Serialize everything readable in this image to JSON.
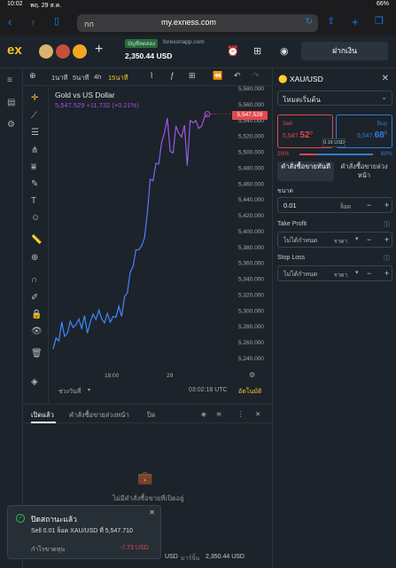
{
  "status_bar": {
    "time": "10:02",
    "date": "พฤ. 29 ส.ค.",
    "battery": "66%"
  },
  "browser": {
    "tab_label": "กก",
    "url": "my.exness.com"
  },
  "app": {
    "logo": "ex",
    "account_badge": "บัญชีทดลอง",
    "account_server": "forexonapp.com",
    "balance": "2,350.44 USD",
    "deposit_label": "ฝากเงิน"
  },
  "chart_toolbar": {
    "timeframes": [
      "1นาที",
      "5นาที",
      "4h",
      "15นาที"
    ],
    "active_timeframe": "15นาที"
  },
  "chart": {
    "title": "Gold vs US Dollar",
    "quote": "5,547.529 +11.732 (+0.21%)",
    "current_price": "5,547.529",
    "x_labels": [
      "18:00",
      "29"
    ],
    "range_label": "ช่วงวันที่",
    "clock": "03:02:18 UTC",
    "auto_label": "อัตโนมัติ"
  },
  "chart_data": {
    "type": "line",
    "title": "Gold vs US Dollar",
    "ylim": [
      5240,
      5580
    ],
    "yticks": [
      5580,
      5560,
      5540,
      5520,
      5500,
      5480,
      5460,
      5440,
      5420,
      5400,
      5380,
      5360,
      5340,
      5320,
      5300,
      5280,
      5260,
      5240
    ],
    "y_tick_labels": [
      "5,580.000",
      "5,560.000",
      "5,540.000",
      "5,520.000",
      "5,500.000",
      "5,480.000",
      "5,460.000",
      "5,440.000",
      "5,420.000",
      "5,400.000",
      "5,380.000",
      "5,360.000",
      "5,340.000",
      "5,320.000",
      "5,300.000",
      "5,280.000",
      "5,260.000",
      "5,240.000"
    ],
    "xlabel": "",
    "ylabel": "",
    "grid": false,
    "series": [
      {
        "values": [
          5252,
          5266,
          5262,
          5286,
          5268,
          5272,
          5287,
          5279,
          5283,
          5290,
          5278,
          5294,
          5272,
          5286,
          5296,
          5289,
          5301,
          5290,
          5285,
          5297,
          5286,
          5293,
          5292,
          5306,
          5293,
          5318,
          5323,
          5349,
          5356,
          5377,
          5377,
          5382,
          5392,
          5423,
          5466,
          5464,
          5486,
          5485,
          5512,
          5525,
          5543,
          5501,
          5499,
          5533,
          5524,
          5519,
          5534,
          5483,
          5540,
          5537,
          5540,
          5530,
          5533,
          5544,
          5548
        ],
        "color_start": "#3d8bfd",
        "color_end": "#b14be0"
      }
    ]
  },
  "panel": {
    "symbol": "XAU/USD",
    "order_type": "โหมดเริ่มต้น",
    "sell": {
      "label": "Sell",
      "price_main": "5,547.",
      "price_big": "52",
      "price_sup": "9"
    },
    "buy": {
      "label": "Buy",
      "price_main": "5,547.",
      "price_big": "68",
      "price_sup": "8"
    },
    "spread": "0.16 USD",
    "sentiment_sell": "20%",
    "sentiment_buy": "80%",
    "mode_market": "คำสั่งซื้อขายทันที",
    "mode_pending": "คำสั่งซื้อขายล่วงหน้า",
    "volume_label": "ขนาด",
    "volume_value": "0.01",
    "volume_unit": "ล็อต",
    "tp_label": "Take Profit",
    "tp_value": "ไม่ได้กำหนด",
    "tp_unit": "ราคา",
    "sl_label": "Stop Loss",
    "sl_value": "ไม่ได้กำหนด",
    "sl_unit": "ราคา"
  },
  "bottom": {
    "tabs": [
      "เปิดแล้ว",
      "คำสั่งซื้อขายล่วงหน้า",
      "ปิด"
    ],
    "empty_text": "ไม่มีคำสั่งซื้อขายที่เปิดอยู่",
    "footer_left": "USD",
    "footer_margin_label": "มาร์จิ้น",
    "footer_margin_value": "2,350.44 USD"
  },
  "toast": {
    "title": "ปิดสถานะแล้ว",
    "body": "Sell 0.01 ล็อต XAU/USD ที่ 5,547.710",
    "pl_label": "กำไรขาดทุน",
    "pl_value": "-7.73 USD"
  }
}
